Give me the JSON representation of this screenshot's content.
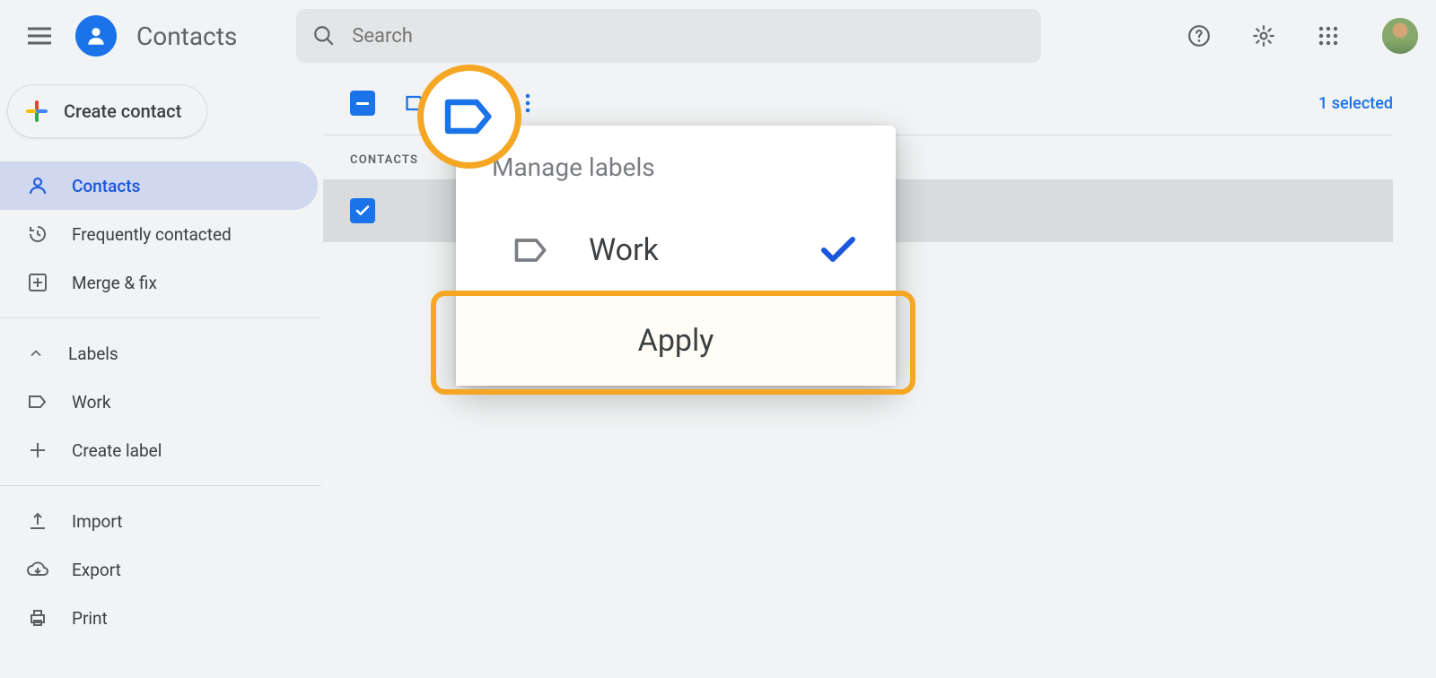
{
  "app": {
    "title": "Contacts"
  },
  "search": {
    "placeholder": "Search"
  },
  "create_btn": {
    "label": "Create contact"
  },
  "sidebar": {
    "items": [
      {
        "label": "Contacts"
      },
      {
        "label": "Frequently contacted"
      },
      {
        "label": "Merge & fix"
      }
    ],
    "labels_header": "Labels",
    "labels": [
      {
        "label": "Work"
      }
    ],
    "create_label": "Create label",
    "actions": [
      {
        "label": "Import"
      },
      {
        "label": "Export"
      },
      {
        "label": "Print"
      }
    ]
  },
  "main": {
    "selected_text": "1 selected",
    "section_header": "CONTACTS"
  },
  "dropdown": {
    "title": "Manage labels",
    "items": [
      {
        "label": "Work",
        "checked": true
      }
    ],
    "apply_label": "Apply"
  }
}
